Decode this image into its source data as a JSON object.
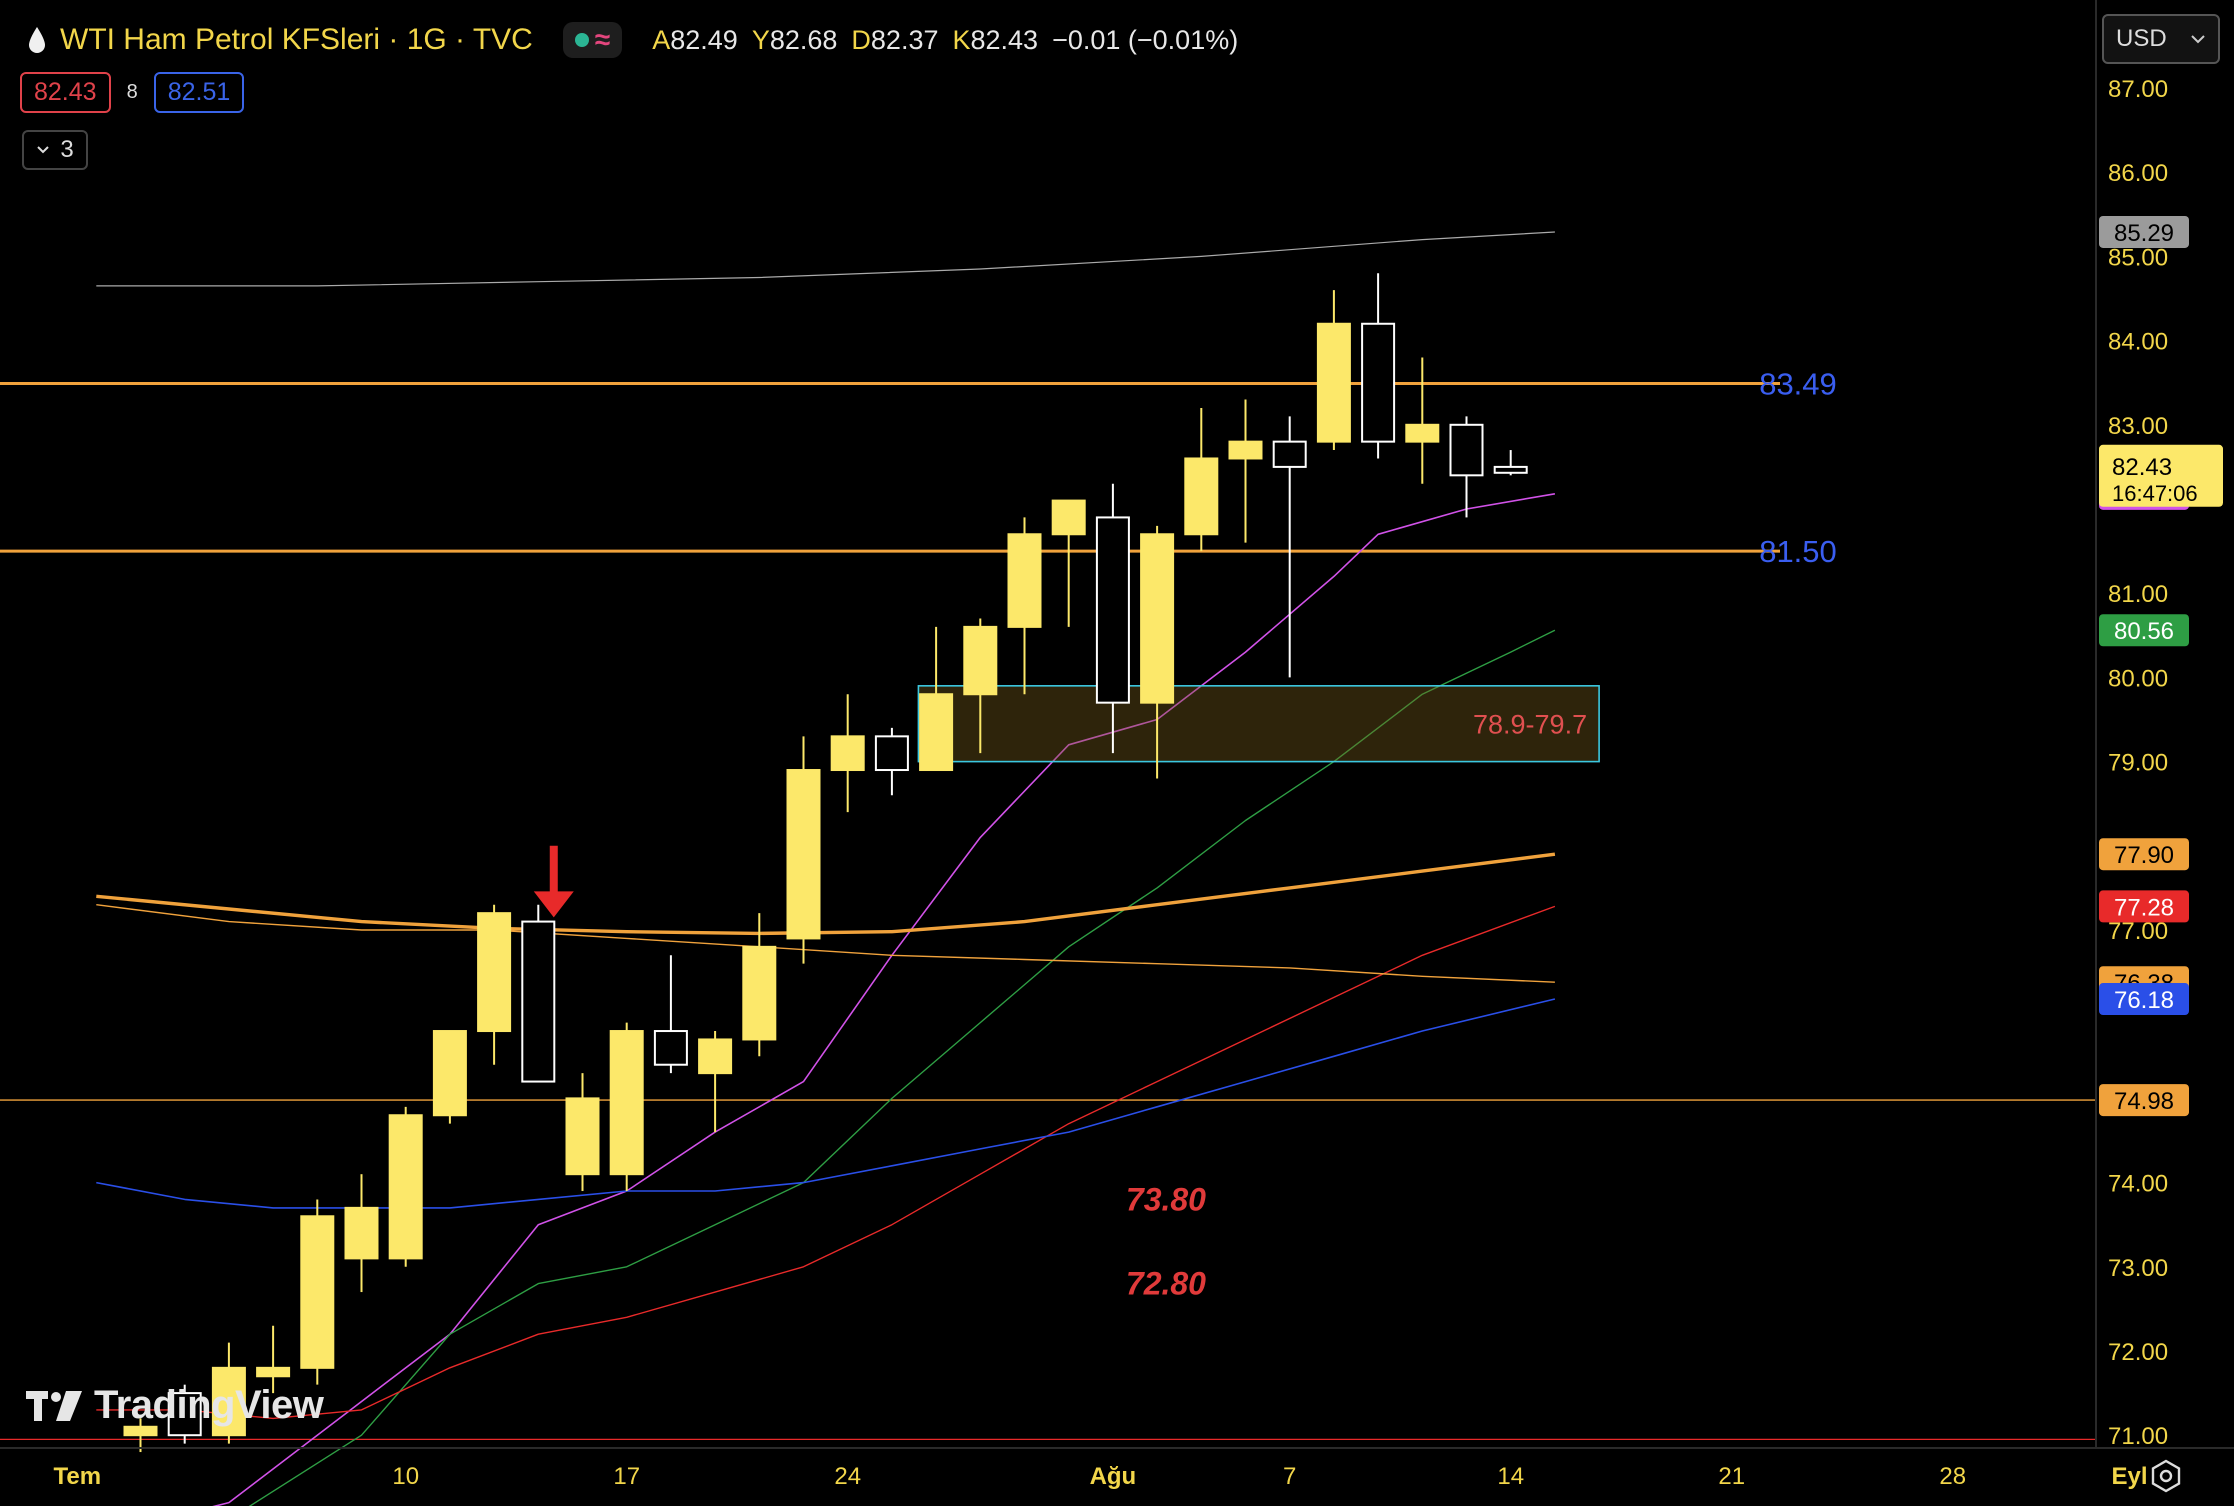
{
  "header": {
    "symbol_title": "WTI Ham Petrol KFSleri · 1G · TVC",
    "open_label": "A",
    "open": "82.49",
    "high_label": "Y",
    "high": "82.68",
    "low_label": "D",
    "low": "82.37",
    "close_label": "K",
    "close": "82.43",
    "change": "−0.01 (−0.01%)"
  },
  "bid": "82.43",
  "spread": "8",
  "ask": "82.51",
  "indicators_collapsed_count": "3",
  "currency": "USD",
  "watermark": "TradingView",
  "colors": {
    "up_candle": "#fce86a",
    "down_candle_border": "#ffffff",
    "background": "#000000",
    "accent": "#f2d64a"
  },
  "chart_data": {
    "type": "candlestick",
    "xlabel_ticks": [
      {
        "i": -1,
        "label": "Tem"
      },
      {
        "i": 6,
        "label": "10"
      },
      {
        "i": 11,
        "label": "17"
      },
      {
        "i": 16,
        "label": "24"
      },
      {
        "i": 22,
        "label": "Ağu"
      },
      {
        "i": 26,
        "label": "7"
      },
      {
        "i": 31,
        "label": "14"
      },
      {
        "i": 36,
        "label": "21"
      },
      {
        "i": 41,
        "label": "28"
      },
      {
        "i": 45,
        "label": "Eyl"
      }
    ],
    "ylim": [
      70.8,
      87.3
    ],
    "y_ticks": [
      71,
      72,
      73,
      74,
      77,
      79,
      80,
      81,
      83,
      84,
      85,
      86,
      87
    ],
    "candles": [
      {
        "i": 0,
        "o": 71.0,
        "h": 71.2,
        "l": 70.8,
        "c": 71.1
      },
      {
        "i": 1,
        "o": 71.5,
        "h": 71.6,
        "l": 70.9,
        "c": 71.0
      },
      {
        "i": 2,
        "o": 71.0,
        "h": 72.1,
        "l": 70.9,
        "c": 71.8
      },
      {
        "i": 3,
        "o": 71.7,
        "h": 72.3,
        "l": 71.5,
        "c": 71.8
      },
      {
        "i": 4,
        "o": 71.8,
        "h": 73.8,
        "l": 71.6,
        "c": 73.6
      },
      {
        "i": 5,
        "o": 73.1,
        "h": 74.1,
        "l": 72.7,
        "c": 73.7
      },
      {
        "i": 6,
        "o": 73.1,
        "h": 74.9,
        "l": 73.0,
        "c": 74.8
      },
      {
        "i": 7,
        "o": 74.8,
        "h": 75.5,
        "l": 74.7,
        "c": 75.8
      },
      {
        "i": 8,
        "o": 75.8,
        "h": 77.3,
        "l": 75.4,
        "c": 77.2
      },
      {
        "i": 9,
        "o": 77.1,
        "h": 77.3,
        "l": 75.2,
        "c": 75.2
      },
      {
        "i": 10,
        "o": 74.1,
        "h": 75.3,
        "l": 73.9,
        "c": 75.0
      },
      {
        "i": 11,
        "o": 74.1,
        "h": 75.9,
        "l": 73.9,
        "c": 75.8
      },
      {
        "i": 12,
        "o": 75.8,
        "h": 76.7,
        "l": 75.3,
        "c": 75.4
      },
      {
        "i": 13,
        "o": 75.3,
        "h": 75.8,
        "l": 74.6,
        "c": 75.7
      },
      {
        "i": 14,
        "o": 75.7,
        "h": 77.2,
        "l": 75.5,
        "c": 76.8
      },
      {
        "i": 15,
        "o": 76.9,
        "h": 79.3,
        "l": 76.6,
        "c": 78.9
      },
      {
        "i": 16,
        "o": 78.9,
        "h": 79.8,
        "l": 78.4,
        "c": 79.3
      },
      {
        "i": 17,
        "o": 79.3,
        "h": 79.4,
        "l": 78.6,
        "c": 78.9
      },
      {
        "i": 18,
        "o": 78.9,
        "h": 80.6,
        "l": 78.9,
        "c": 79.8
      },
      {
        "i": 19,
        "o": 79.8,
        "h": 80.7,
        "l": 79.1,
        "c": 80.6
      },
      {
        "i": 20,
        "o": 80.6,
        "h": 81.9,
        "l": 79.8,
        "c": 81.7
      },
      {
        "i": 21,
        "o": 81.7,
        "h": 82.0,
        "l": 80.6,
        "c": 82.1
      },
      {
        "i": 22,
        "o": 81.9,
        "h": 82.3,
        "l": 79.1,
        "c": 79.7
      },
      {
        "i": 23,
        "o": 79.7,
        "h": 81.8,
        "l": 78.8,
        "c": 81.7
      },
      {
        "i": 24,
        "o": 81.7,
        "h": 83.2,
        "l": 81.5,
        "c": 82.6
      },
      {
        "i": 25,
        "o": 82.6,
        "h": 83.3,
        "l": 81.6,
        "c": 82.8
      },
      {
        "i": 26,
        "o": 82.8,
        "h": 83.1,
        "l": 80.0,
        "c": 82.5
      },
      {
        "i": 27,
        "o": 82.8,
        "h": 84.6,
        "l": 82.7,
        "c": 84.2
      },
      {
        "i": 28,
        "o": 84.2,
        "h": 84.8,
        "l": 82.6,
        "c": 82.8
      },
      {
        "i": 29,
        "o": 82.8,
        "h": 83.8,
        "l": 82.3,
        "c": 83.0
      },
      {
        "i": 30,
        "o": 83.0,
        "h": 83.1,
        "l": 81.9,
        "c": 82.4
      },
      {
        "i": 31,
        "o": 82.5,
        "h": 82.7,
        "l": 82.4,
        "c": 82.43
      }
    ],
    "moving_averages": [
      {
        "color": "#d152e8",
        "width": 1.6,
        "points": [
          [
            -1,
            69.8
          ],
          [
            2,
            70.2
          ],
          [
            4,
            71.0
          ],
          [
            7,
            72.2
          ],
          [
            9,
            73.5
          ],
          [
            11,
            73.9
          ],
          [
            13,
            74.6
          ],
          [
            15,
            75.2
          ],
          [
            17,
            76.7
          ],
          [
            19,
            78.1
          ],
          [
            21,
            79.2
          ],
          [
            23,
            79.5
          ],
          [
            25,
            80.3
          ],
          [
            27,
            81.2
          ],
          [
            28,
            81.7
          ],
          [
            30,
            82.0
          ],
          [
            32,
            82.18
          ]
        ]
      },
      {
        "color": "#2e9e44",
        "width": 1.4,
        "points": [
          [
            -1,
            69.4
          ],
          [
            2,
            70.0
          ],
          [
            5,
            71.0
          ],
          [
            7,
            72.2
          ],
          [
            9,
            72.8
          ],
          [
            11,
            73.0
          ],
          [
            13,
            73.5
          ],
          [
            15,
            74.0
          ],
          [
            17,
            75.0
          ],
          [
            19,
            75.9
          ],
          [
            21,
            76.8
          ],
          [
            23,
            77.5
          ],
          [
            25,
            78.3
          ],
          [
            27,
            79.0
          ],
          [
            29,
            79.8
          ],
          [
            31,
            80.3
          ],
          [
            32,
            80.56
          ]
        ]
      },
      {
        "color": "#e82a2a",
        "width": 1.4,
        "points": [
          [
            -1,
            71.3
          ],
          [
            1,
            71.3
          ],
          [
            3,
            71.2
          ],
          [
            5,
            71.3
          ],
          [
            7,
            71.8
          ],
          [
            9,
            72.2
          ],
          [
            11,
            72.4
          ],
          [
            13,
            72.7
          ],
          [
            15,
            73.0
          ],
          [
            17,
            73.5
          ],
          [
            19,
            74.1
          ],
          [
            21,
            74.7
          ],
          [
            23,
            75.2
          ],
          [
            25,
            75.7
          ],
          [
            27,
            76.2
          ],
          [
            29,
            76.7
          ],
          [
            32,
            77.28
          ]
        ]
      },
      {
        "color": "#2a4fe8",
        "width": 1.6,
        "points": [
          [
            -1,
            74.0
          ],
          [
            1,
            73.8
          ],
          [
            3,
            73.7
          ],
          [
            5,
            73.7
          ],
          [
            7,
            73.7
          ],
          [
            9,
            73.8
          ],
          [
            11,
            73.9
          ],
          [
            13,
            73.9
          ],
          [
            15,
            74.0
          ],
          [
            17,
            74.2
          ],
          [
            19,
            74.4
          ],
          [
            21,
            74.6
          ],
          [
            23,
            74.9
          ],
          [
            25,
            75.2
          ],
          [
            27,
            75.5
          ],
          [
            29,
            75.8
          ],
          [
            32,
            76.18
          ]
        ]
      },
      {
        "color": "#f0a23c",
        "width": 1.4,
        "points": [
          [
            -1,
            77.3
          ],
          [
            2,
            77.1
          ],
          [
            5,
            77.0
          ],
          [
            8,
            77.0
          ],
          [
            11,
            76.9
          ],
          [
            14,
            76.8
          ],
          [
            17,
            76.7
          ],
          [
            20,
            76.65
          ],
          [
            23,
            76.6
          ],
          [
            26,
            76.55
          ],
          [
            29,
            76.45
          ],
          [
            32,
            76.38
          ]
        ]
      },
      {
        "color": "#f0a23c",
        "width": 3.4,
        "points": [
          [
            -1,
            77.4
          ],
          [
            2,
            77.25
          ],
          [
            5,
            77.1
          ],
          [
            8,
            77.02
          ],
          [
            11,
            76.98
          ],
          [
            14,
            76.96
          ],
          [
            17,
            76.98
          ],
          [
            20,
            77.1
          ],
          [
            23,
            77.3
          ],
          [
            26,
            77.5
          ],
          [
            29,
            77.7
          ],
          [
            32,
            77.9
          ]
        ]
      },
      {
        "color": "#aaaaaa",
        "width": 1.2,
        "points": [
          [
            -1,
            84.65
          ],
          [
            4,
            84.65
          ],
          [
            9,
            84.7
          ],
          [
            14,
            84.75
          ],
          [
            19,
            84.85
          ],
          [
            24,
            85.0
          ],
          [
            29,
            85.2
          ],
          [
            32,
            85.29
          ]
        ]
      }
    ],
    "horizontal_lines": [
      {
        "value": 83.49,
        "color": "#f0a23c",
        "width": 3
      },
      {
        "value": 81.5,
        "color": "#f0a23c",
        "width": 3
      },
      {
        "value": 74.98,
        "color": "#f0a23c",
        "width": 1.4
      },
      {
        "value": 70.95,
        "color": "#e82a2a",
        "width": 1.2
      }
    ],
    "zone": {
      "from_i": 17.6,
      "to_i": 33.0,
      "low": 79.0,
      "high": 79.9,
      "label": "78.9-79.7"
    },
    "annotations": [
      {
        "text": "83.49",
        "i": 37.5,
        "y": 83.49,
        "color": "#3a5ef0",
        "italic": false
      },
      {
        "text": "81.50",
        "i": 37.5,
        "y": 81.5,
        "color": "#3a5ef0",
        "italic": false
      },
      {
        "text": "73.80",
        "i": 23.2,
        "y": 73.8,
        "color": "#e03a3a",
        "italic": true
      },
      {
        "text": "72.80",
        "i": 23.2,
        "y": 72.8,
        "color": "#e03a3a",
        "italic": true
      }
    ],
    "arrow": {
      "i": 9.35,
      "from_y": 78.0,
      "to_y": 77.15,
      "color": "#e82a2a"
    },
    "price_badges": [
      {
        "value": 85.29,
        "bg": "#9b9b9b",
        "fg": "#000000"
      },
      {
        "value": 82.18,
        "bg": "#d152e8",
        "fg": "#ffffff"
      },
      {
        "value": 80.56,
        "bg": "#2e9e44",
        "fg": "#ffffff"
      },
      {
        "value": 77.9,
        "bg": "#f0a23c",
        "fg": "#000000"
      },
      {
        "value": 77.28,
        "bg": "#e82a2a",
        "fg": "#ffffff"
      },
      {
        "value": 76.38,
        "bg": "#f0a23c",
        "fg": "#000000"
      },
      {
        "value": 76.18,
        "bg": "#2a4fe8",
        "fg": "#ffffff"
      },
      {
        "value": 74.98,
        "bg": "#f0a23c",
        "fg": "#000000"
      }
    ],
    "last_price": {
      "value": "82.43",
      "countdown": "16:47:06",
      "bg": "#fce86a",
      "fg": "#000000"
    }
  }
}
